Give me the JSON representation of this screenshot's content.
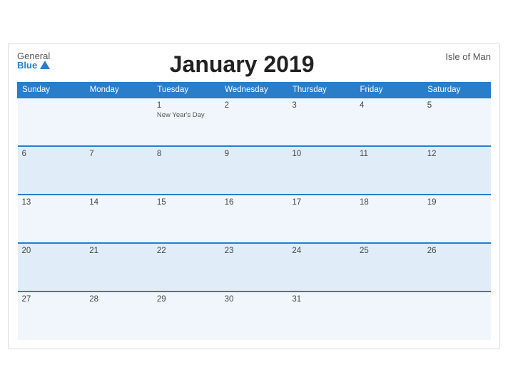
{
  "header": {
    "logo_general": "General",
    "logo_blue": "Blue",
    "title": "January 2019",
    "region": "Isle of Man"
  },
  "weekdays": [
    "Sunday",
    "Monday",
    "Tuesday",
    "Wednesday",
    "Thursday",
    "Friday",
    "Saturday"
  ],
  "weeks": [
    [
      {
        "day": "",
        "holiday": ""
      },
      {
        "day": "",
        "holiday": ""
      },
      {
        "day": "1",
        "holiday": "New Year's Day"
      },
      {
        "day": "2",
        "holiday": ""
      },
      {
        "day": "3",
        "holiday": ""
      },
      {
        "day": "4",
        "holiday": ""
      },
      {
        "day": "5",
        "holiday": ""
      }
    ],
    [
      {
        "day": "6",
        "holiday": ""
      },
      {
        "day": "7",
        "holiday": ""
      },
      {
        "day": "8",
        "holiday": ""
      },
      {
        "day": "9",
        "holiday": ""
      },
      {
        "day": "10",
        "holiday": ""
      },
      {
        "day": "11",
        "holiday": ""
      },
      {
        "day": "12",
        "holiday": ""
      }
    ],
    [
      {
        "day": "13",
        "holiday": ""
      },
      {
        "day": "14",
        "holiday": ""
      },
      {
        "day": "15",
        "holiday": ""
      },
      {
        "day": "16",
        "holiday": ""
      },
      {
        "day": "17",
        "holiday": ""
      },
      {
        "day": "18",
        "holiday": ""
      },
      {
        "day": "19",
        "holiday": ""
      }
    ],
    [
      {
        "day": "20",
        "holiday": ""
      },
      {
        "day": "21",
        "holiday": ""
      },
      {
        "day": "22",
        "holiday": ""
      },
      {
        "day": "23",
        "holiday": ""
      },
      {
        "day": "24",
        "holiday": ""
      },
      {
        "day": "25",
        "holiday": ""
      },
      {
        "day": "26",
        "holiday": ""
      }
    ],
    [
      {
        "day": "27",
        "holiday": ""
      },
      {
        "day": "28",
        "holiday": ""
      },
      {
        "day": "29",
        "holiday": ""
      },
      {
        "day": "30",
        "holiday": ""
      },
      {
        "day": "31",
        "holiday": ""
      },
      {
        "day": "",
        "holiday": ""
      },
      {
        "day": "",
        "holiday": ""
      }
    ]
  ]
}
